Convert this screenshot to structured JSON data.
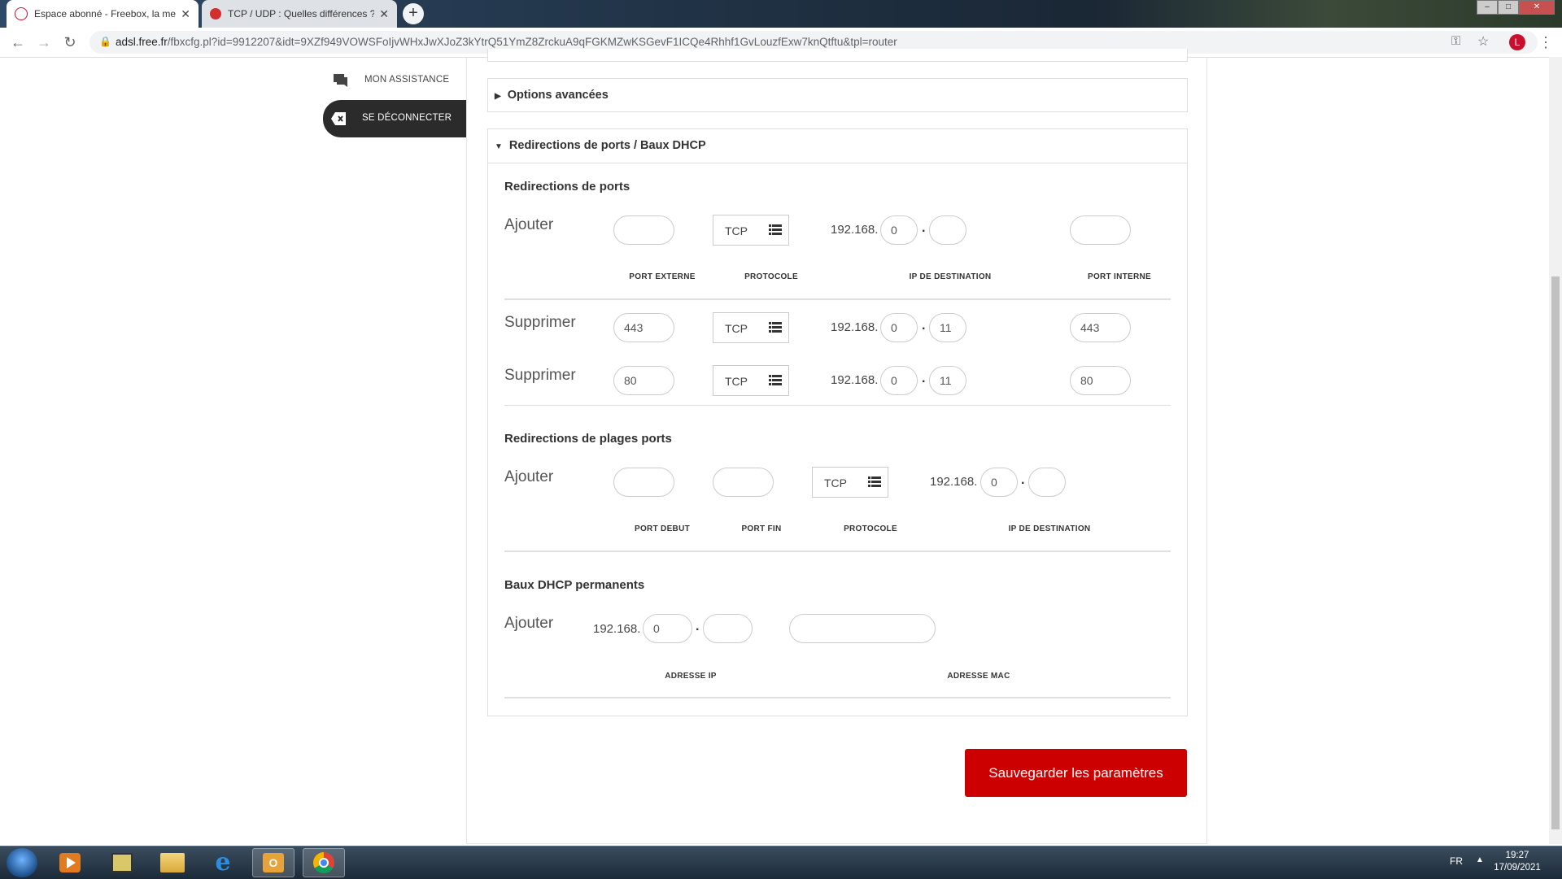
{
  "browser": {
    "tabs": [
      {
        "title": "Espace abonné - Freebox, la meil",
        "active": true
      },
      {
        "title": "TCP / UDP : Quelles différences ?",
        "active": false
      }
    ],
    "new_tab_label": "+",
    "close_glyph": "✕",
    "url_host": "adsl.free.fr",
    "url_rest": "/fbxcfg.pl?id=9912207&idt=9XZf949VOWSFoIjvWHxJwXJoZ3kYtrQ51YmZ8ZrckuA9qFGKMZwKSGevF1ICQe4Rhhf1GvLouzfExw7knQtftu&tpl=router",
    "profile_initial": "L",
    "window_controls": [
      "–",
      "□",
      "✕"
    ]
  },
  "sidebar": {
    "assistance_label": "MON ASSISTANCE",
    "logout_label": "SE DÉCONNECTER"
  },
  "advanced_options": {
    "title": "Options avancées"
  },
  "redirections_panel": {
    "title": "Redirections de ports / Baux DHCP",
    "port_redirections": {
      "title": "Redirections de ports",
      "add_label": "Ajouter",
      "new_row": {
        "external_port": "",
        "protocol": "TCP",
        "ip_prefix": "192.168.",
        "ip_octet3": "0",
        "ip_octet4": "",
        "internal_port": ""
      },
      "columns": [
        "PORT EXTERNE",
        "PROTOCOLE",
        "IP DE DESTINATION",
        "PORT INTERNE"
      ],
      "rows": [
        {
          "action": "Supprimer",
          "external_port": "443",
          "protocol": "TCP",
          "ip_prefix": "192.168.",
          "ip_octet3": "0",
          "ip_octet4": "11",
          "internal_port": "443"
        },
        {
          "action": "Supprimer",
          "external_port": "80",
          "protocol": "TCP",
          "ip_prefix": "192.168.",
          "ip_octet3": "0",
          "ip_octet4": "11",
          "internal_port": "80"
        }
      ]
    },
    "range_redirections": {
      "title": "Redirections de plages ports",
      "add_label": "Ajouter",
      "new_row": {
        "port_start": "",
        "port_end": "",
        "protocol": "TCP",
        "ip_prefix": "192.168.",
        "ip_octet3": "0",
        "ip_octet4": ""
      },
      "columns": [
        "PORT DEBUT",
        "PORT FIN",
        "PROTOCOLE",
        "IP DE DESTINATION"
      ]
    },
    "dhcp_leases": {
      "title": "Baux DHCP permanents",
      "add_label": "Ajouter",
      "new_row": {
        "ip_prefix": "192.168.",
        "ip_octet3": "0",
        "ip_octet4": "",
        "mac": ""
      },
      "columns": [
        "ADRESSE IP",
        "ADRESSE MAC"
      ]
    }
  },
  "save_button": {
    "label": "Sauvegarder les paramètres"
  },
  "taskbar": {
    "apps": [
      "windows-media-player-icon",
      "file-manager-icon",
      "explorer-folder-icon",
      "internet-explorer-icon",
      "outlook-icon",
      "chrome-icon"
    ],
    "language": "FR",
    "time": "19:27",
    "date": "17/09/2021"
  },
  "colors": {
    "accent": "#cc0000",
    "sidebar_dark": "#2b2b2b"
  }
}
